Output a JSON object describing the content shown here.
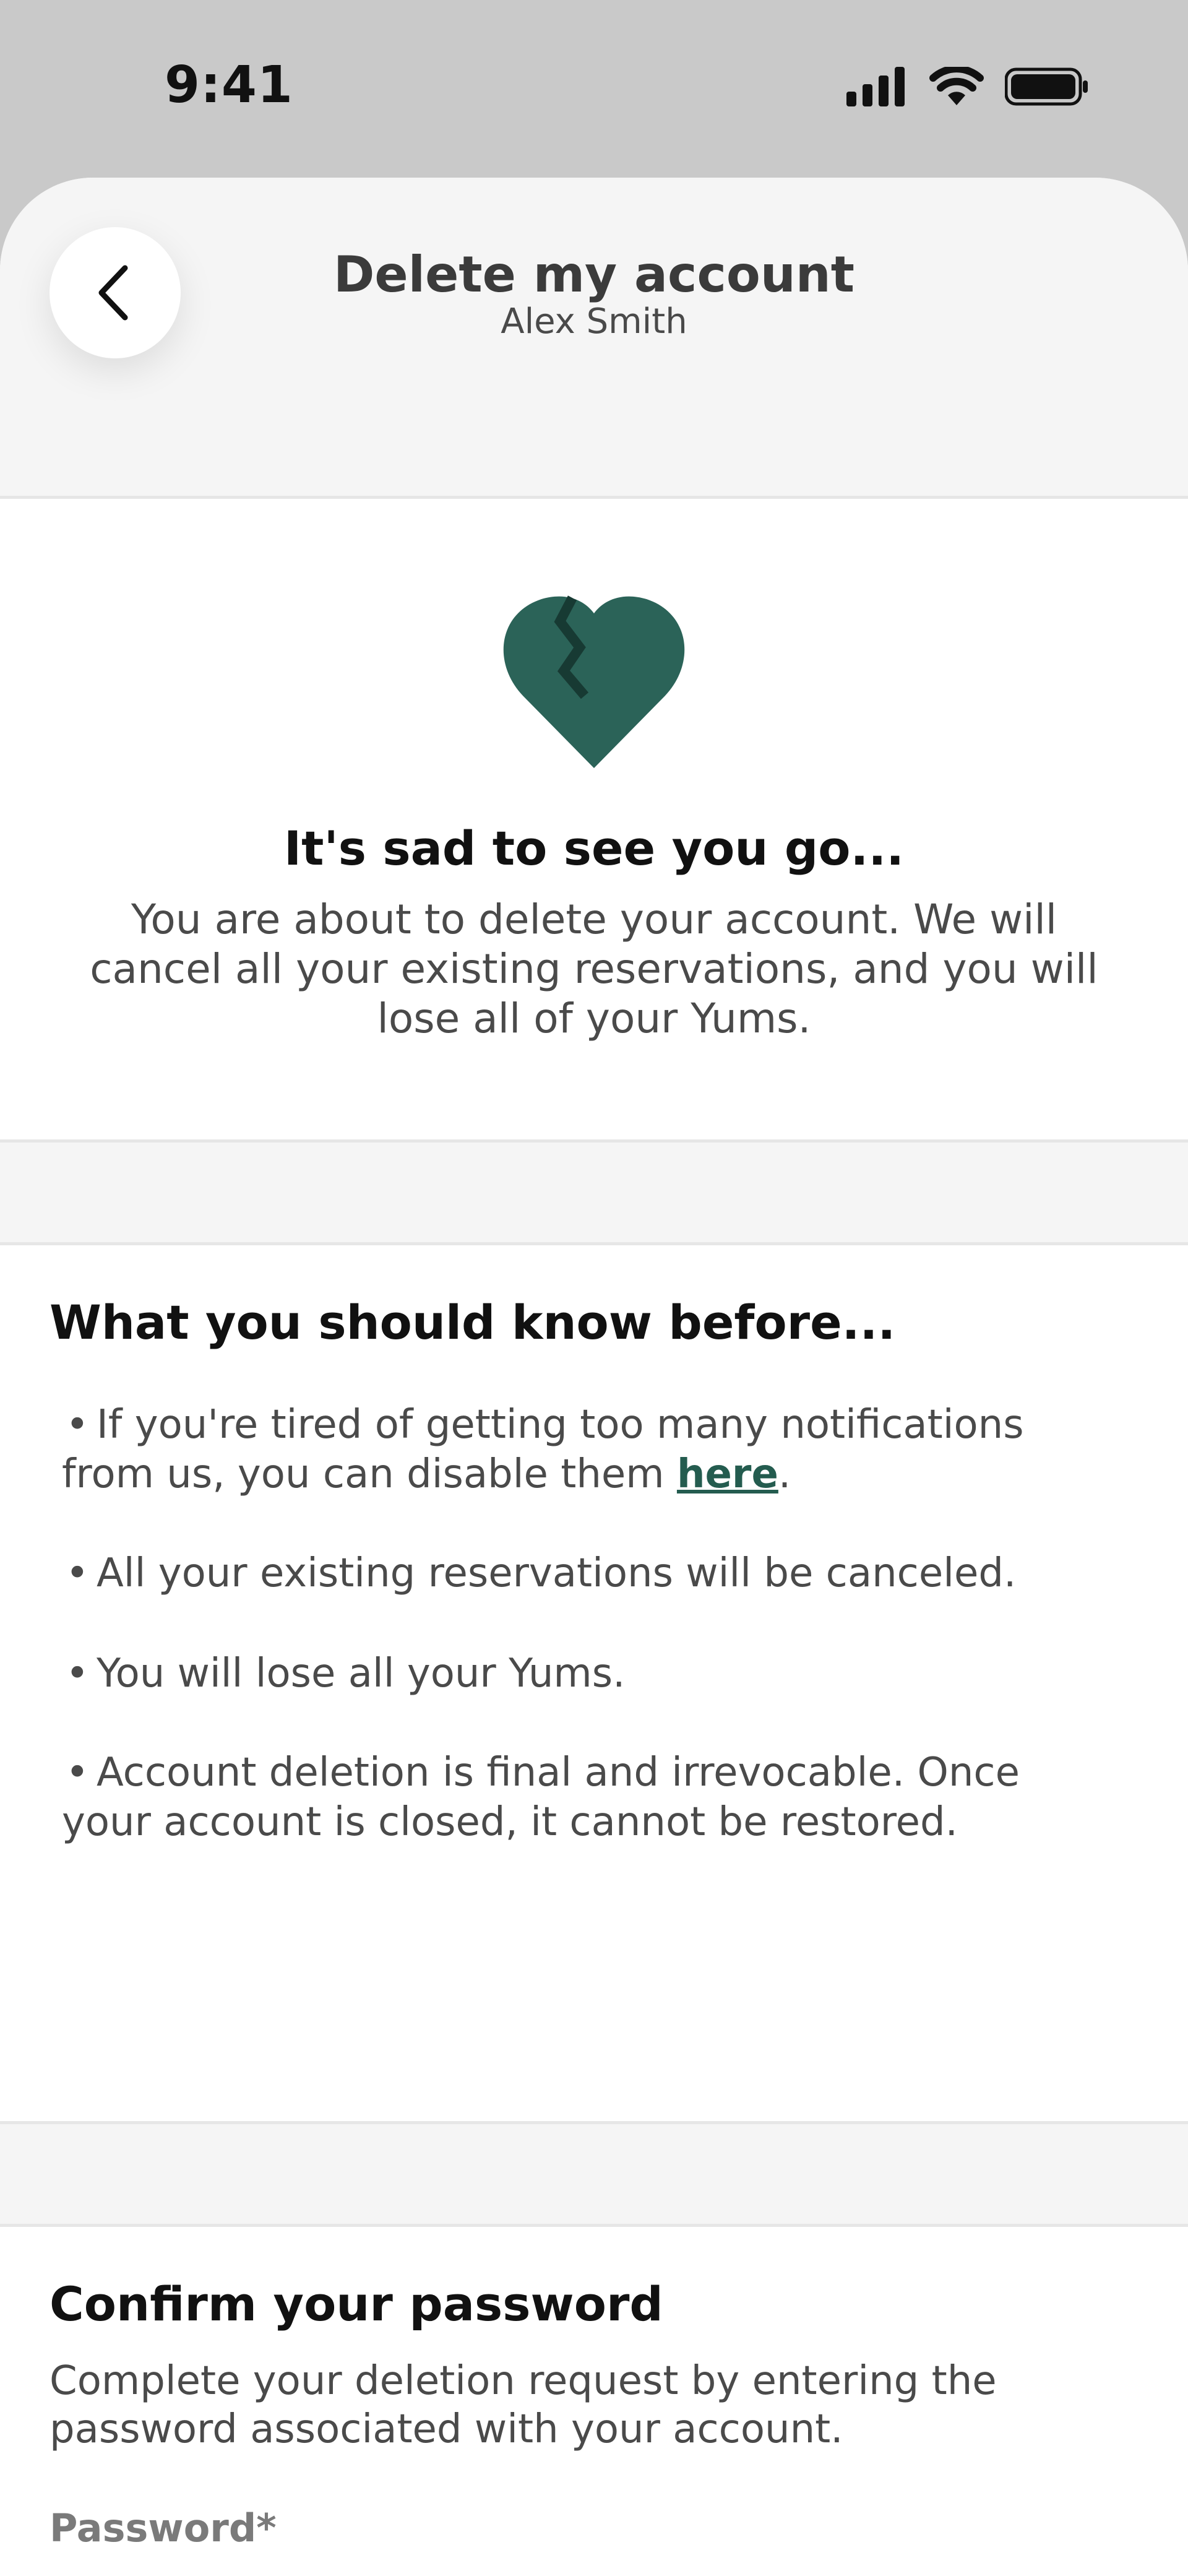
{
  "status_bar": {
    "time": "9:41"
  },
  "header": {
    "title": "Delete my account",
    "subtitle": "Alex Smith"
  },
  "sad_card": {
    "title": "It's sad to see you go...",
    "text": "You are about to delete your account. We will cancel all your existing reservations, and you will lose all of your Yums."
  },
  "know_card": {
    "title": "What you should know before...",
    "bullets": [
      {
        "before": "If you're tired of getting too many notifications from us, you can disable them ",
        "link": "here",
        "after": "."
      },
      {
        "text": "All your existing reservations will be canceled."
      },
      {
        "text": "You will lose all your Yums."
      },
      {
        "text": "Account deletion is final and irrevocable. Once your account is closed, it cannot be restored."
      }
    ]
  },
  "confirm_card": {
    "title": "Confirm your password",
    "text": "Complete your deletion request by entering the password associated with your account.",
    "password_label": "Password*",
    "password_value": ""
  },
  "colors": {
    "accent": "#2b6358",
    "background": "#f5f5f5"
  },
  "icons": {
    "back": "chevron-left-icon",
    "hero": "broken-heart-icon",
    "toggle": "eye-closed-icon"
  }
}
